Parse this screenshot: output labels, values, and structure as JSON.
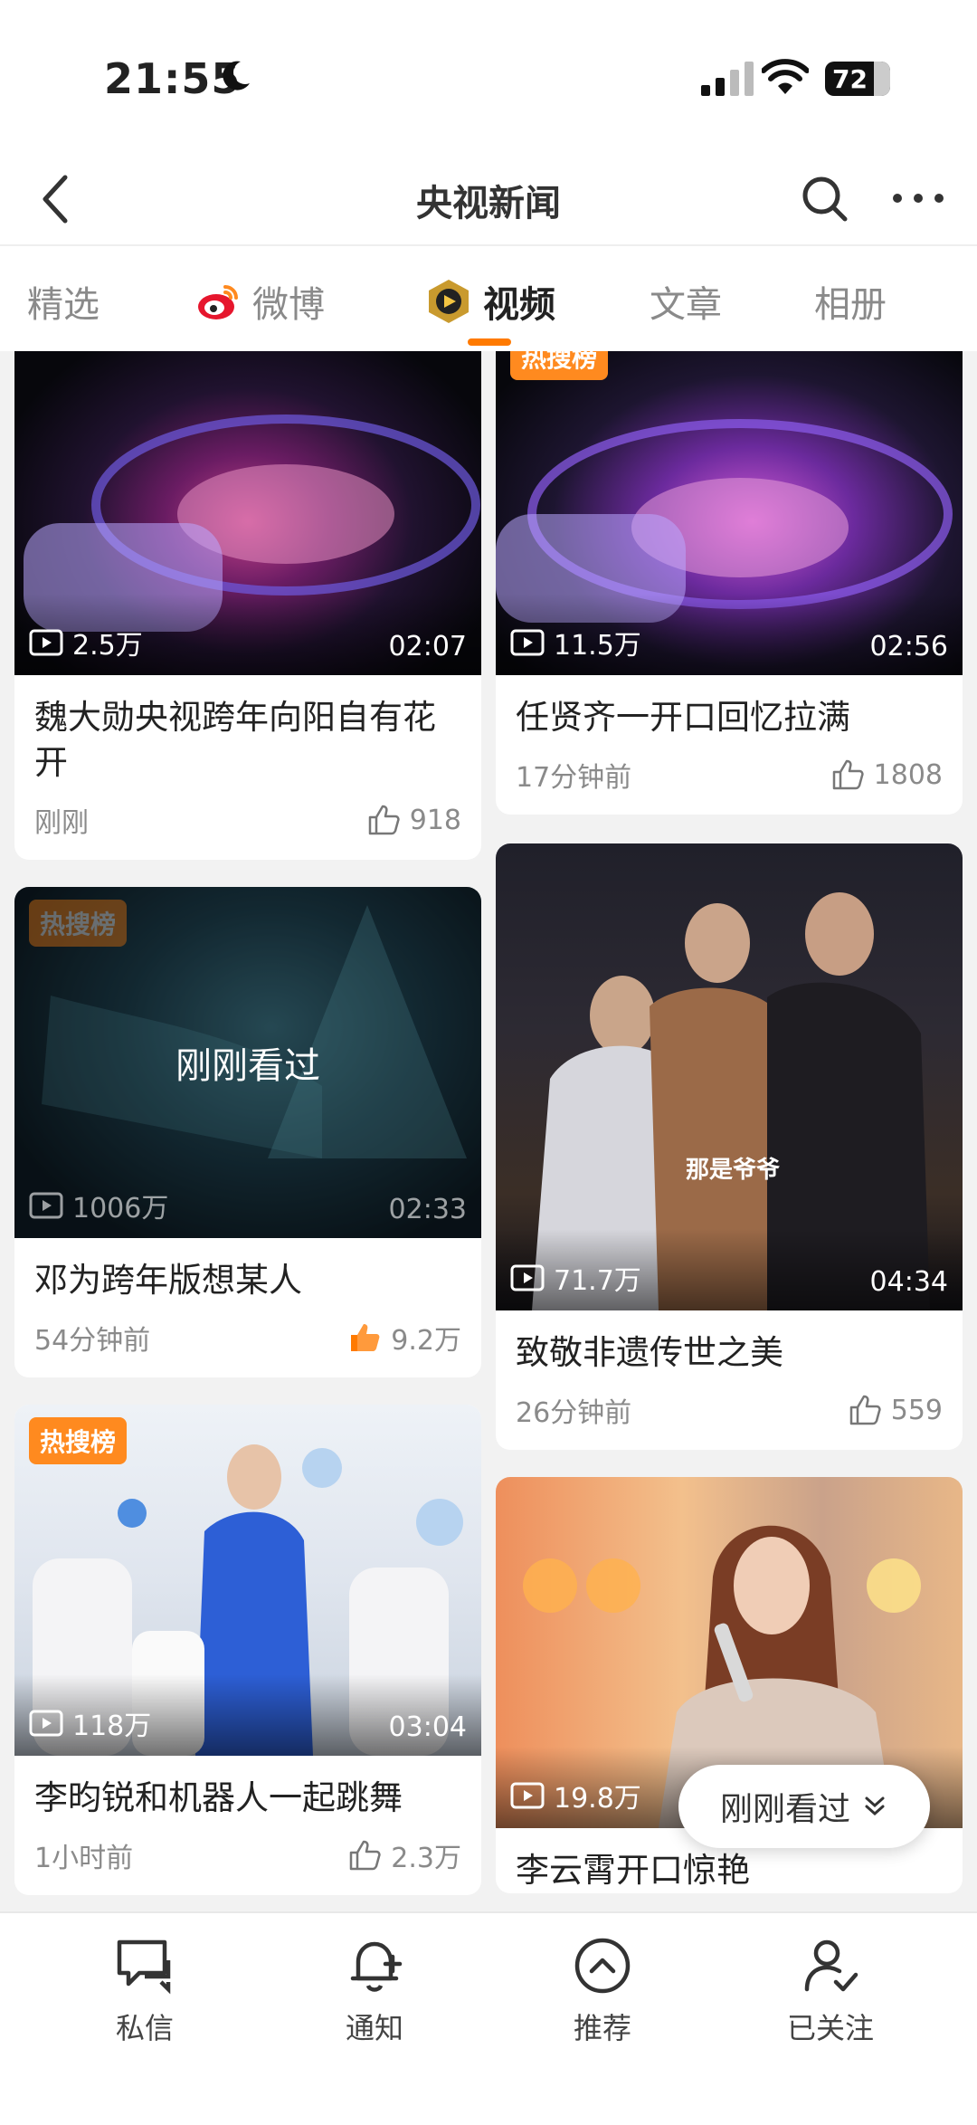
{
  "status_bar": {
    "time": "21:55",
    "battery": "72"
  },
  "nav": {
    "title": "央视新闻"
  },
  "tabs": [
    {
      "label": "精选"
    },
    {
      "label": "微博"
    },
    {
      "label": "视频"
    },
    {
      "label": "文章"
    },
    {
      "label": "相册"
    }
  ],
  "active_tab": "视频",
  "accent_color": "#ff7a00",
  "cards": [
    {
      "title": "魏大勋央视跨年向阳自有花开",
      "views": "2.5万",
      "duration": "02:07",
      "time": "刚刚",
      "likes": "918",
      "hot": ""
    },
    {
      "title": "任贤齐一开口回忆拉满",
      "views": "11.5万",
      "duration": "02:56",
      "time": "17分钟前",
      "likes": "1808",
      "hot": "热搜榜"
    },
    {
      "title": "邓为跨年版想某人",
      "views": "1006万",
      "duration": "02:33",
      "time": "54分钟前",
      "likes": "9.2万",
      "hot": "热搜榜",
      "overlay": "刚刚看过"
    },
    {
      "title": "致敬非遗传世之美",
      "views": "71.7万",
      "duration": "04:34",
      "time": "26分钟前",
      "likes": "559",
      "hot": "",
      "subtitle": "那是爷爷"
    },
    {
      "title": "李昀锐和机器人一起跳舞",
      "views": "118万",
      "duration": "03:04",
      "time": "1小时前",
      "likes": "2.3万",
      "hot": "热搜榜"
    },
    {
      "title": "李云霄开口惊艳",
      "views": "19.8万",
      "duration": "",
      "time": "",
      "likes": "",
      "hot": ""
    }
  ],
  "floating_button": {
    "label": "刚刚看过"
  },
  "bottom_nav": [
    {
      "label": "私信",
      "icon": "chat-icon"
    },
    {
      "label": "通知",
      "icon": "bell-plus-icon"
    },
    {
      "label": "推荐",
      "icon": "chevron-up-circle-icon"
    },
    {
      "label": "已关注",
      "icon": "user-check-icon"
    }
  ]
}
